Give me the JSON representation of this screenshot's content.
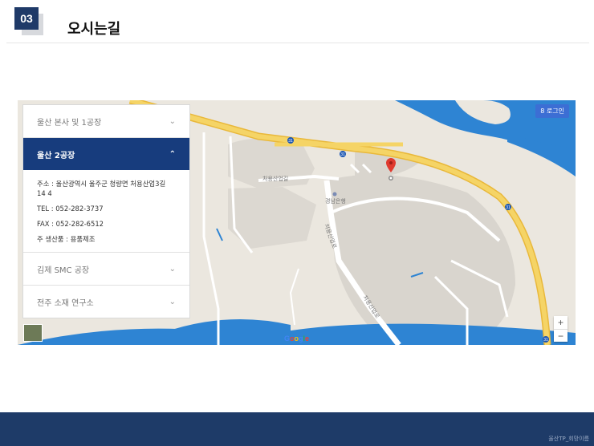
{
  "section": {
    "number": "03",
    "title": "오시는길"
  },
  "map": {
    "login_label": "로그인",
    "zoom_in": "+",
    "zoom_out": "−",
    "google_logo": "Google",
    "labels": {
      "road_31": "31",
      "road_name_a": "처용산업길",
      "road_name_b": "처용산업로",
      "road_name_c": "처용산업로",
      "bank": "경남은행"
    },
    "colors": {
      "water": "#2e84d3",
      "highway": "#f5cf54",
      "marker": "#e03a2f"
    }
  },
  "accordion": {
    "items": [
      {
        "label": "울산 본사 및 1공장",
        "expanded": false
      },
      {
        "label": "울산 2공장",
        "expanded": true,
        "details": [
          "주소 : 울산광역시 울주군 청량면 처용산업3길 14 4",
          "TEL : 052-282-3737",
          "FAX : 052-282-6512",
          "주 생산품 : 용품제조"
        ]
      },
      {
        "label": "김제 SMC 공장",
        "expanded": false
      },
      {
        "label": "전주 소재 연구소",
        "expanded": false
      }
    ]
  },
  "footer": {
    "text": "울산TP_회망이름"
  }
}
